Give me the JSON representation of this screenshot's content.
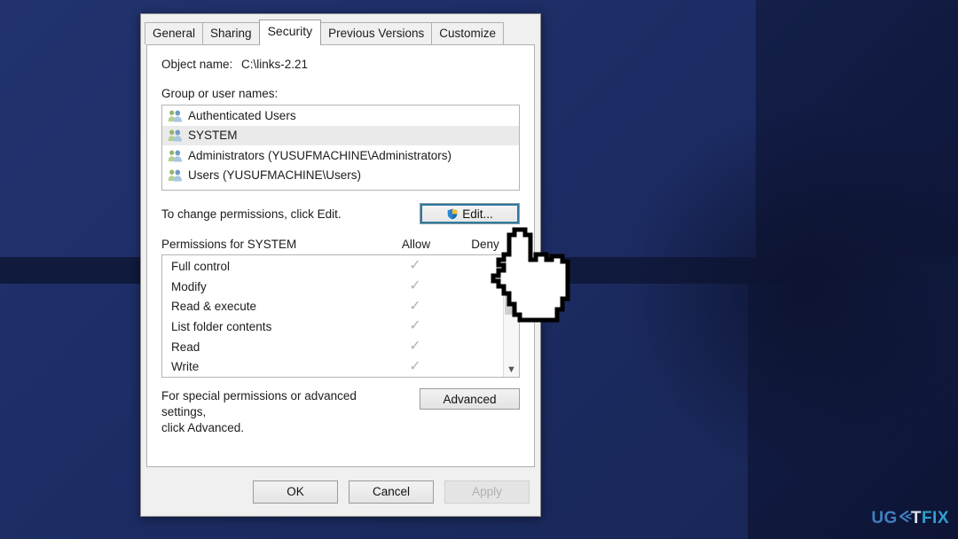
{
  "dialog": {
    "tabs": [
      {
        "label": "General",
        "active": false
      },
      {
        "label": "Sharing",
        "active": false
      },
      {
        "label": "Security",
        "active": true
      },
      {
        "label": "Previous Versions",
        "active": false
      },
      {
        "label": "Customize",
        "active": false
      }
    ],
    "object_name_label": "Object name:",
    "object_name_value": "C:\\links-2.21",
    "group_label": "Group or user names:",
    "groups": [
      {
        "name": "Authenticated Users",
        "icon": "users-icon",
        "selected": false
      },
      {
        "name": "SYSTEM",
        "icon": "users-icon",
        "selected": true
      },
      {
        "name": "Administrators (YUSUFMACHINE\\Administrators)",
        "icon": "users-icon",
        "selected": false
      },
      {
        "name": "Users (YUSUFMACHINE\\Users)",
        "icon": "users-icon",
        "selected": false
      }
    ],
    "edit_hint": "To change permissions, click Edit.",
    "edit_button": "Edit...",
    "edit_button_icon": "uac-shield-icon",
    "permissions_title": "Permissions for SYSTEM",
    "col_allow": "Allow",
    "col_deny": "Deny",
    "permissions": [
      {
        "name": "Full control",
        "allow": "✓",
        "deny": ""
      },
      {
        "name": "Modify",
        "allow": "✓",
        "deny": ""
      },
      {
        "name": "Read & execute",
        "allow": "✓",
        "deny": ""
      },
      {
        "name": "List folder contents",
        "allow": "✓",
        "deny": ""
      },
      {
        "name": "Read",
        "allow": "✓",
        "deny": ""
      },
      {
        "name": "Write",
        "allow": "✓",
        "deny": ""
      }
    ],
    "advanced_hint_line1": "For special permissions or advanced settings,",
    "advanced_hint_line2": "click Advanced.",
    "advanced_button": "Advanced",
    "footer": {
      "ok": "OK",
      "cancel": "Cancel",
      "apply": "Apply",
      "apply_disabled": true
    }
  },
  "watermark": {
    "part1": "UG",
    "part2": "T",
    "part3": "FIX",
    "arrow_icon": "arrow-left-icon"
  },
  "cursor": {
    "icon": "pointing-hand-cursor"
  },
  "colors": {
    "desktop_blue": "#1d2e66",
    "desktop_dark": "#101a3d",
    "dialog_bg": "#f0f0f0",
    "focus_ring": "#2e7b9e",
    "selection": "#eaeaea",
    "check_gray": "#b2b2b2",
    "watermark_blue": "#3f7fbf",
    "watermark_cyan": "#2f9fd0"
  }
}
